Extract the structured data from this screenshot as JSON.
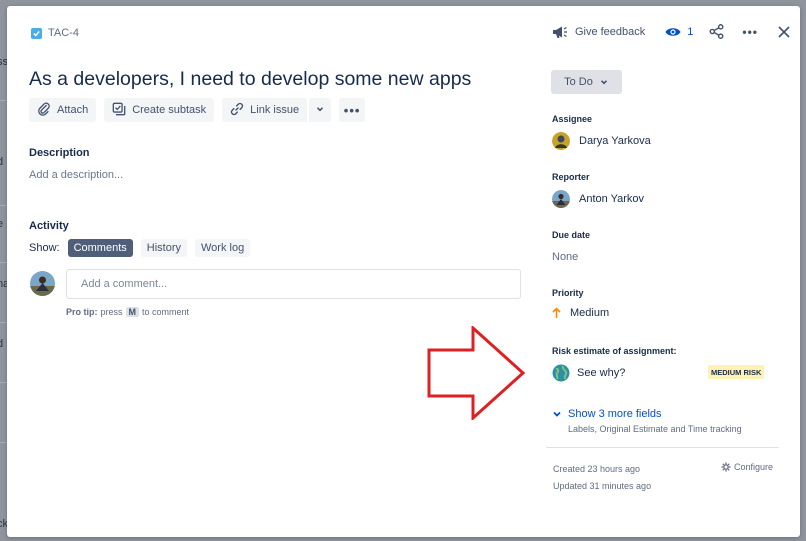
{
  "background_fragments": [
    "ss",
    "d",
    "e",
    "na",
    "d",
    "t",
    "ck"
  ],
  "issue": {
    "key": "TAC-4",
    "title": "As a developers, I need to develop some new apps"
  },
  "actions": {
    "attach": "Attach",
    "create_subtask": "Create subtask",
    "link_issue": "Link issue"
  },
  "description": {
    "heading": "Description",
    "placeholder": "Add a description..."
  },
  "activity": {
    "heading": "Activity",
    "show_label": "Show:",
    "tabs": [
      {
        "label": "Comments",
        "active": true
      },
      {
        "label": "History",
        "active": false
      },
      {
        "label": "Work log",
        "active": false
      }
    ],
    "comment_placeholder": "Add a comment...",
    "protip_label": "Pro tip:",
    "protip_press": "press",
    "protip_key": "M",
    "protip_suffix": "to comment"
  },
  "header": {
    "feedback": "Give feedback",
    "watchers": "1"
  },
  "status": {
    "label": "To Do"
  },
  "fields": {
    "assignee_label": "Assignee",
    "assignee_value": "Darya Yarkova",
    "reporter_label": "Reporter",
    "reporter_value": "Anton Yarkov",
    "due_label": "Due date",
    "due_value": "None",
    "priority_label": "Priority",
    "priority_value": "Medium",
    "risk_label": "Risk estimate of assignment:",
    "risk_link": "See why?",
    "risk_badge": "MEDIUM RISK"
  },
  "more_fields": {
    "link": "Show 3 more fields",
    "sub": "Labels, Original Estimate and Time tracking"
  },
  "meta": {
    "created": "Created 23 hours ago",
    "updated": "Updated 31 minutes ago",
    "configure": "Configure"
  },
  "colors": {
    "accent": "#0052cc",
    "arrow": "#e02020",
    "badge_bg": "#fff0b3",
    "active_tab": "#505f79",
    "priority": "#ff8b00"
  },
  "icons": [
    "checkbox-icon",
    "paperclip-icon",
    "subtask-icon",
    "link-icon",
    "chevron-down-icon",
    "more-icon",
    "megaphone-icon",
    "eye-icon",
    "share-icon",
    "close-icon",
    "arrow-up-icon",
    "globe-icon",
    "gear-icon"
  ]
}
